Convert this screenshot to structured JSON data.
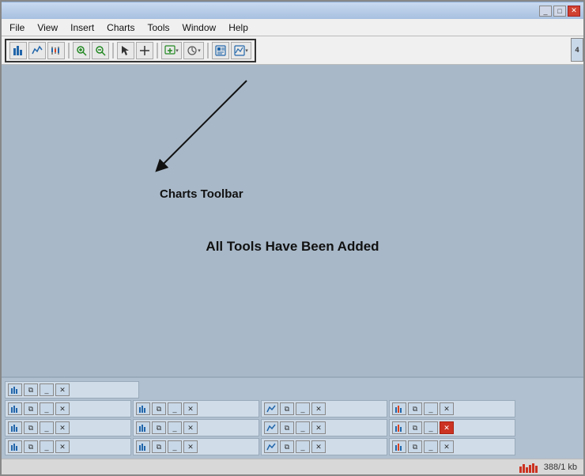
{
  "titleBar": {
    "text": "",
    "minimizeLabel": "_",
    "maximizeLabel": "□",
    "closeLabel": "✕"
  },
  "menuBar": {
    "items": [
      "File",
      "View",
      "Insert",
      "Charts",
      "Tools",
      "Window",
      "Help"
    ]
  },
  "toolbar": {
    "tools": [
      {
        "id": "t1",
        "icon": "📊",
        "label": "chart-bar-icon"
      },
      {
        "id": "t2",
        "icon": "📈",
        "label": "chart-line-icon"
      },
      {
        "id": "t3",
        "icon": "📉",
        "label": "chart-wave-icon"
      },
      {
        "id": "t4",
        "icon": "🔍+",
        "label": "zoom-in-icon"
      },
      {
        "id": "t5",
        "icon": "🔍-",
        "label": "zoom-out-icon"
      },
      {
        "sep": true
      },
      {
        "id": "t6",
        "icon": "↖",
        "label": "pointer-icon"
      },
      {
        "id": "t7",
        "icon": "↕",
        "label": "crosshair-icon"
      },
      {
        "sep": true
      },
      {
        "id": "t8",
        "icon": "⊞▾",
        "label": "new-chart-icon",
        "arrow": true
      },
      {
        "id": "t9",
        "icon": "⏱▾",
        "label": "timeframe-icon",
        "arrow": true
      },
      {
        "sep": true
      },
      {
        "id": "t10",
        "icon": "⊡",
        "label": "template-icon"
      },
      {
        "id": "t11",
        "icon": "⊠▾",
        "label": "indicator-icon",
        "arrow": true
      }
    ]
  },
  "mainContent": {
    "annotationLabel": "Charts Toolbar",
    "allToolsLabel": "All Tools Have Been Added"
  },
  "bottomPanel": {
    "rows": [
      {
        "windows": [
          {
            "type": "first",
            "btns": [
              "chart",
              "restore",
              "minimize",
              "close"
            ]
          }
        ]
      },
      {
        "windows": [
          {
            "type": "normal",
            "btns": [
              "chart",
              "restore",
              "minimize",
              "close"
            ]
          },
          {
            "type": "normal",
            "btns": [
              "chart",
              "restore",
              "minimize",
              "close"
            ]
          },
          {
            "type": "normal",
            "btns": [
              "chart",
              "restore",
              "minimize",
              "close"
            ]
          },
          {
            "type": "normal",
            "btns": [
              "chart",
              "restore",
              "minimize",
              "close"
            ]
          }
        ]
      },
      {
        "windows": [
          {
            "type": "normal",
            "btns": [
              "chart",
              "restore",
              "minimize",
              "close"
            ]
          },
          {
            "type": "normal",
            "btns": [
              "chart",
              "restore",
              "minimize",
              "close"
            ]
          },
          {
            "type": "normal",
            "btns": [
              "chart",
              "restore",
              "minimize",
              "close"
            ]
          },
          {
            "type": "normal",
            "btns": [
              "chart",
              "restore",
              "minimize",
              "close_red"
            ]
          }
        ]
      },
      {
        "windows": [
          {
            "type": "normal",
            "btns": [
              "chart",
              "restore",
              "minimize",
              "close"
            ]
          },
          {
            "type": "normal",
            "btns": [
              "chart",
              "restore",
              "minimize",
              "close"
            ]
          },
          {
            "type": "normal",
            "btns": [
              "chart",
              "restore",
              "minimize",
              "close"
            ]
          },
          {
            "type": "normal",
            "btns": [
              "chart",
              "restore",
              "minimize",
              "close"
            ]
          }
        ]
      }
    ]
  },
  "statusBar": {
    "sideNumber": "4",
    "statusText": "388/1 kb"
  }
}
